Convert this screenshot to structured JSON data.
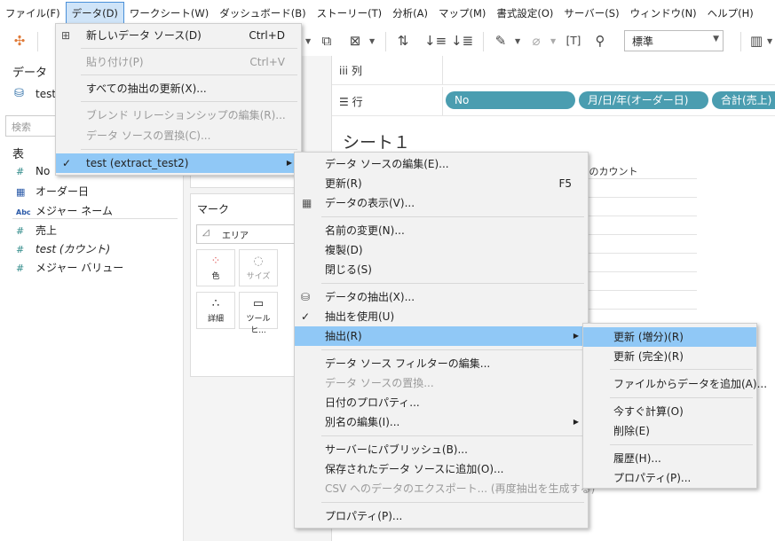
{
  "menubar": [
    "ファイル(F)",
    "データ(D)",
    "ワークシート(W)",
    "ダッシュボード(B)",
    "ストーリー(T)",
    "分析(A)",
    "マップ(M)",
    "書式設定(O)",
    "サーバー(S)",
    "ウィンドウ(N)",
    "ヘルプ(H)"
  ],
  "toolbar": {
    "format_select": "標準"
  },
  "data_pane": {
    "title": "データ",
    "source_name": "test",
    "search_placeholder": "検索",
    "table_header": "表",
    "fields": [
      {
        "icon": "#",
        "name": "No"
      },
      {
        "icon": "date",
        "name": "オーダー日"
      },
      {
        "icon": "Abc",
        "name": "メジャー ネーム"
      },
      {
        "icon": "#",
        "name": "売上"
      },
      {
        "icon": "#",
        "name": "test (カウント)"
      },
      {
        "icon": "#",
        "name": "メジャー バリュー"
      }
    ]
  },
  "marks": {
    "title": "マーク",
    "type": "エリア",
    "buttons": [
      "色",
      "サイズ",
      "詳細",
      "ツールヒ..."
    ]
  },
  "shelves": {
    "columns_label": "列",
    "rows_label": "行",
    "row_pills": [
      "No",
      "月/日/年(オーダー日)",
      "合計(売上)"
    ]
  },
  "sheet": {
    "title": "シート１",
    "column_header": "st のカウント"
  },
  "data_menu": [
    {
      "label": "新しいデータ ソース(D)",
      "shortcut": "Ctrl+D"
    },
    {
      "label": "貼り付け(P)",
      "shortcut": "Ctrl+V",
      "disabled": true
    },
    {
      "label": "すべての抽出の更新(X)..."
    },
    {
      "label": "ブレンド リレーションシップの編集(R)...",
      "disabled": true
    },
    {
      "label": "データ ソースの置換(C)...",
      "disabled": true
    },
    {
      "label": "test (extract_test2)",
      "checked": true
    }
  ],
  "source_menu": [
    {
      "label": "データ ソースの編集(E)..."
    },
    {
      "label": "更新(R)",
      "shortcut": "F5"
    },
    {
      "label": "データの表示(V)..."
    },
    {
      "label": "名前の変更(N)..."
    },
    {
      "label": "複製(D)"
    },
    {
      "label": "閉じる(S)"
    },
    {
      "label": "データの抽出(X)..."
    },
    {
      "label": "抽出を使用(U)",
      "checked": true
    },
    {
      "label": "抽出(R)"
    },
    {
      "label": "データ ソース フィルターの編集..."
    },
    {
      "label": "データ ソースの置換...",
      "disabled": true
    },
    {
      "label": "日付のプロパティ..."
    },
    {
      "label": "別名の編集(I)..."
    },
    {
      "label": "サーバーにパブリッシュ(B)..."
    },
    {
      "label": "保存されたデータ ソースに追加(O)..."
    },
    {
      "label": "CSV へのデータのエクスポート... (再度抽出を生成する)",
      "disabled": true
    },
    {
      "label": "プロパティ(P)..."
    }
  ],
  "extract_menu": [
    {
      "label": "更新 (増分)(R)"
    },
    {
      "label": "更新 (完全)(R)"
    },
    {
      "label": "ファイルからデータを追加(A)..."
    },
    {
      "label": "今すぐ計算(O)"
    },
    {
      "label": "削除(E)"
    },
    {
      "label": "履歴(H)..."
    },
    {
      "label": "プロパティ(P)..."
    }
  ],
  "colors": {
    "menu_highlight": "#90c8f6",
    "pill": "#4a9db0",
    "field_icon": "#2f8a89"
  }
}
